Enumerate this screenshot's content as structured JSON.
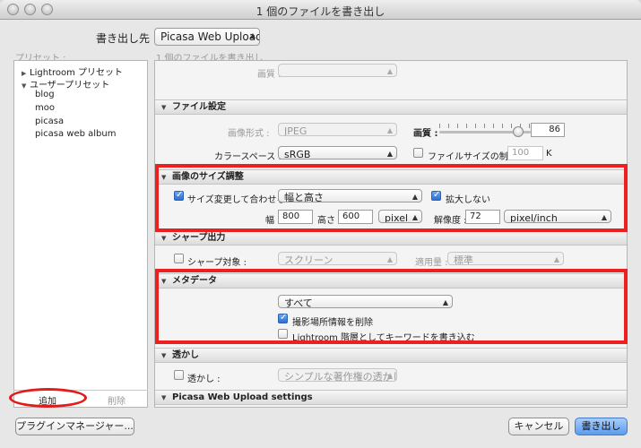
{
  "window": {
    "title": "1 個のファイルを書き出し"
  },
  "destination": {
    "label": "書き出し先 :",
    "value": "Picasa Web Upload"
  },
  "presets": {
    "header": "プリセット :",
    "groups": [
      {
        "label": "Lightroom プリセット",
        "expanded": false
      },
      {
        "label": "ユーザープリセット",
        "expanded": true
      }
    ],
    "user_presets": [
      "blog",
      "moo",
      "picasa",
      "picasa web album"
    ],
    "add_label": "追加",
    "remove_label": "削除"
  },
  "subtitle": "1 個のファイルを書き出し",
  "top_stub": {
    "label": "画質 :"
  },
  "file_settings": {
    "header": "ファイル設定",
    "format_label": "画像形式 :",
    "format_value": "JPEG",
    "quality_label": "画質 :",
    "quality_value": "86",
    "quality_fraction": 0.86,
    "colorspace_label": "カラースペース :",
    "colorspace_value": "sRGB",
    "size_limit_label": "ファイルサイズの制限 :",
    "size_limit_value": "100",
    "size_limit_unit": "K"
  },
  "image_sizing": {
    "header": "画像のサイズ調整",
    "resize_label": "サイズ変更して合わせる :",
    "resize_checked": true,
    "resize_mode": "幅と高さ",
    "dont_enlarge_label": "拡大しない",
    "dont_enlarge_checked": true,
    "width_label": "幅 :",
    "width_value": "800",
    "height_label": "高さ :",
    "height_value": "600",
    "unit_value": "pixel",
    "resolution_label": "解像度 :",
    "resolution_value": "72",
    "resolution_unit": "pixel/inch"
  },
  "sharpening": {
    "header": "シャープ出力",
    "target_label": "シャープ対象 :",
    "target_value": "スクリーン",
    "amount_label": "適用量 :",
    "amount_value": "標準"
  },
  "metadata": {
    "header": "メタデータ",
    "include_value": "すべて",
    "remove_location_label": "撮影場所情報を削除",
    "remove_location_checked": true,
    "keywords_label": "Lightroom 階層としてキーワードを書き込む",
    "keywords_checked": false
  },
  "watermark": {
    "header": "透かし",
    "label": "透かし :",
    "value": "シンプルな著作権の透かし"
  },
  "picasa_settings": {
    "header": "Picasa Web Upload settings"
  },
  "buttons": {
    "plugin_manager": "プラグインマネージャー...",
    "cancel": "キャンセル",
    "export": "書き出し"
  },
  "colors": {
    "highlight": "#ee1f1f",
    "primary_button": "#5b9bef"
  }
}
